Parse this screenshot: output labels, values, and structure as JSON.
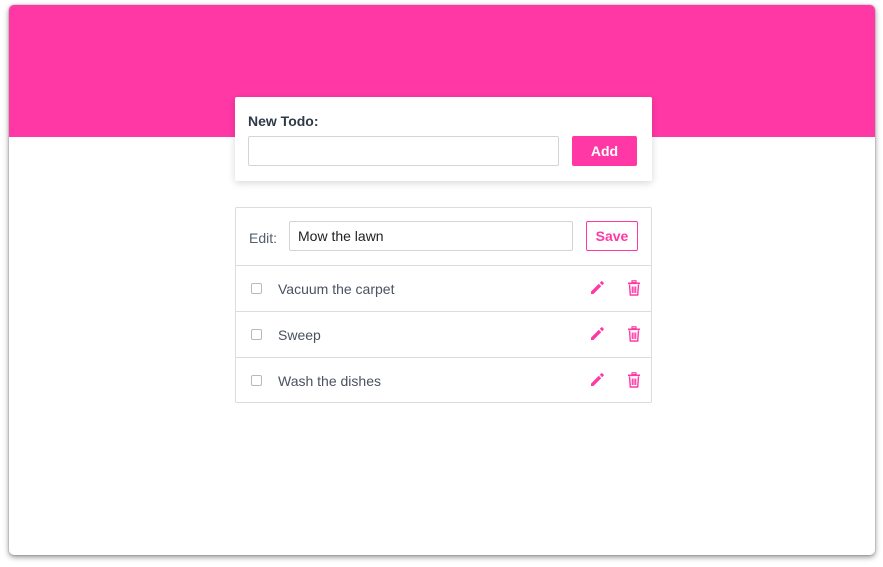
{
  "colors": {
    "accent": "#ff38a6",
    "text": "#4a5260",
    "border": "#dcdcdc"
  },
  "new_todo": {
    "label": "New Todo:",
    "input_value": "",
    "add_label": "Add"
  },
  "edit": {
    "label": "Edit:",
    "input_value": "Mow the lawn",
    "save_label": "Save"
  },
  "todos": [
    {
      "text": "Vacuum the carpet",
      "done": false,
      "edit_icon": "pencil-icon",
      "delete_icon": "trash-icon"
    },
    {
      "text": "Sweep",
      "done": false,
      "edit_icon": "pencil-icon",
      "delete_icon": "trash-icon"
    },
    {
      "text": "Wash the dishes",
      "done": false,
      "edit_icon": "pencil-icon",
      "delete_icon": "trash-icon"
    }
  ]
}
